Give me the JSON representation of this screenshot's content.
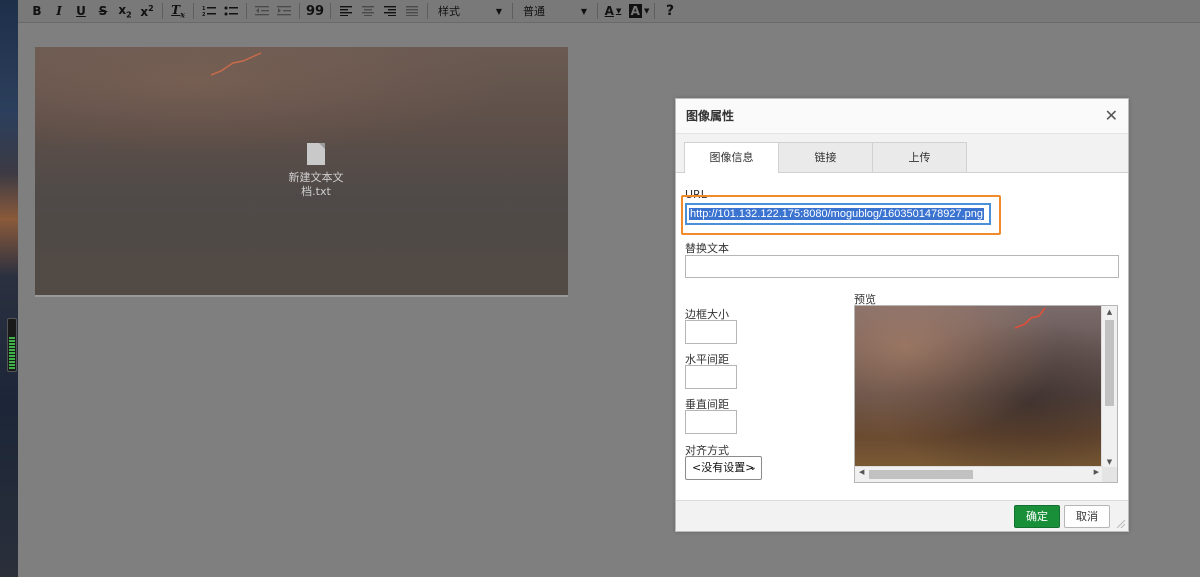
{
  "toolbar": {
    "bold": "B",
    "italic": "I",
    "underline": "U",
    "strike": "S",
    "subscript_base": "x",
    "subscript_mark": "2",
    "superscript_base": "x",
    "superscript_mark": "2",
    "remove_format": "T",
    "remove_format_mark": "x",
    "blockquote": "99",
    "style_combo": "样式",
    "format_combo": "普通",
    "text_color": "A",
    "bg_color": "A",
    "help": "?"
  },
  "content": {
    "file_name": "新建文本文档.txt",
    "file_name_line1": "新建文本文",
    "file_name_line2": "档.txt"
  },
  "dialog": {
    "title": "图像属性",
    "close": "✕",
    "tabs": [
      {
        "label": "图像信息",
        "active": true
      },
      {
        "label": "链接",
        "active": false
      },
      {
        "label": "上传",
        "active": false
      }
    ],
    "url_label": "URL",
    "url_value": "http://101.132.122.175:8080/mogublog/1603501478927.png",
    "alt_label": "替换文本",
    "alt_value": "",
    "border_label": "边框大小",
    "hspace_label": "水平间距",
    "vspace_label": "垂直间距",
    "align_label": "对齐方式",
    "align_value": "<没有设置>",
    "preview_label": "预览",
    "ok": "确定",
    "cancel": "取消"
  },
  "colors": {
    "highlight": "#f08a2a",
    "ok_button": "#1a8f3a",
    "selection": "#3a73d0"
  }
}
